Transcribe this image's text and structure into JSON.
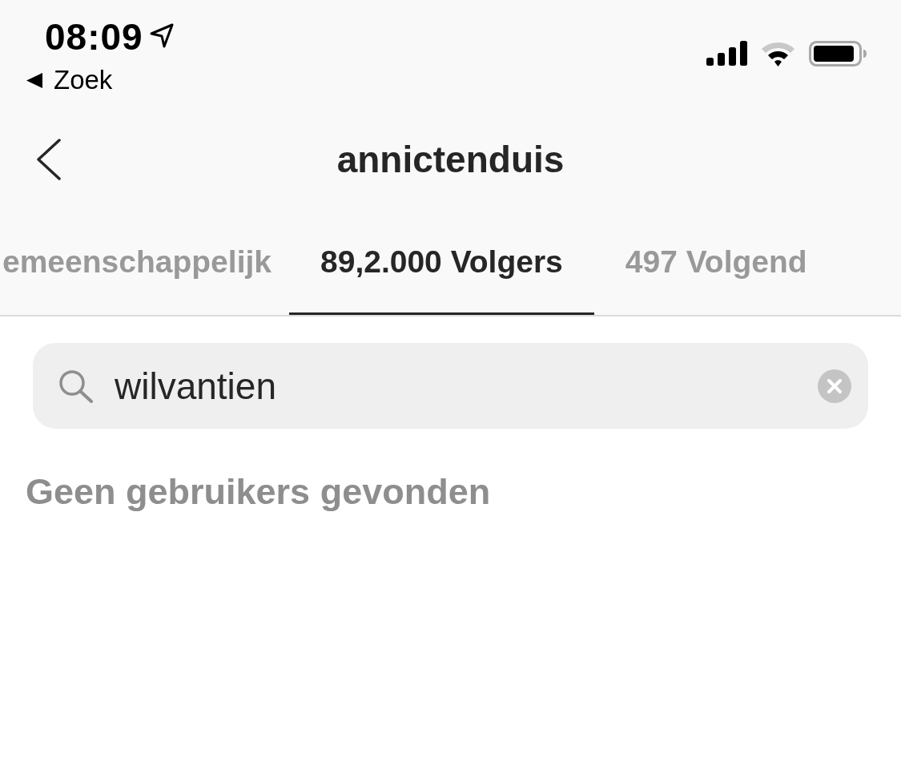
{
  "status_bar": {
    "time": "08:09",
    "back_link": "Zoek"
  },
  "nav": {
    "title": "annictenduis"
  },
  "tabs": [
    {
      "label": "emeenschappelijk",
      "selected": false
    },
    {
      "label": "89,2.000 Volgers",
      "selected": true
    },
    {
      "label": "497 Volgend",
      "selected": false
    }
  ],
  "search": {
    "value": "wilvantien"
  },
  "empty_message": "Geen gebruikers gevonden"
}
